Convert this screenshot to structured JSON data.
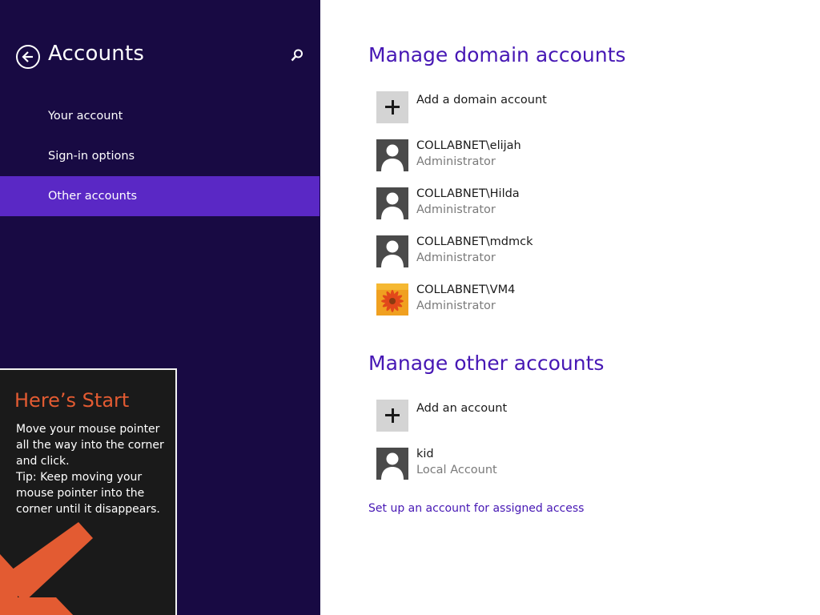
{
  "left_pane": {
    "title": "Accounts",
    "nav": [
      "Your account",
      "Sign-in options",
      "Other accounts"
    ],
    "active_index": 2,
    "colors": {
      "background": "#180a43",
      "active": "#5a28c5"
    }
  },
  "tip": {
    "title": "Here’s Start",
    "body_lines": [
      "Move your mouse pointer all the way into the corner and click.",
      "Tip: Keep moving your mouse pointer into the corner until it disappears."
    ]
  },
  "domain_section": {
    "title": "Manage domain accounts",
    "add_label": "Add a domain account",
    "accounts": [
      {
        "name": "COLLABNET\\elijah",
        "role": "Administrator",
        "picture": "user-silhouette-icon"
      },
      {
        "name": "COLLABNET\\Hilda",
        "role": "Administrator",
        "picture": "user-silhouette-icon"
      },
      {
        "name": "COLLABNET\\mdmck",
        "role": "Administrator",
        "picture": "user-silhouette-icon"
      },
      {
        "name": "COLLABNET\\VM4",
        "role": "Administrator",
        "picture": "flower-photo"
      }
    ]
  },
  "other_section": {
    "title": "Manage other accounts",
    "add_label": "Add an account",
    "accounts": [
      {
        "name": "kid",
        "role": "Local Account",
        "picture": "user-silhouette-icon"
      }
    ]
  },
  "assigned_access_link": "Set up an account for assigned access",
  "colors": {
    "accent": "#4617b4",
    "tip_title": "#e35b32"
  }
}
